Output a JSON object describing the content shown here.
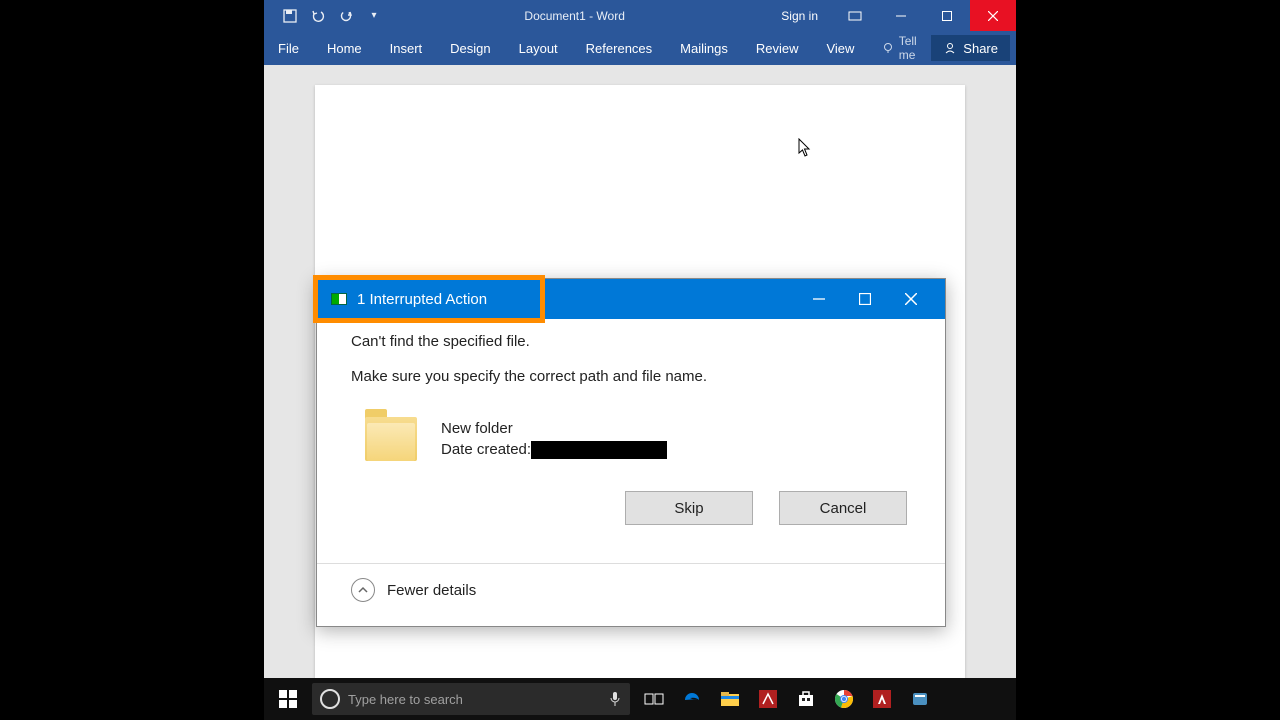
{
  "word": {
    "doc_title": "Document1  -  Word",
    "signin": "Sign in",
    "tabs": [
      "File",
      "Home",
      "Insert",
      "Design",
      "Layout",
      "References",
      "Mailings",
      "Review",
      "View"
    ],
    "tellme": "Tell me",
    "share": "Share"
  },
  "dialog": {
    "title": "1 Interrupted Action",
    "error_main": "Can't find the specified file.",
    "error_sub": "Make sure you specify the correct path and file name.",
    "item_name": "New folder",
    "date_label": "Date created:",
    "skip": "Skip",
    "cancel": "Cancel",
    "fewer": "Fewer details"
  },
  "taskbar": {
    "search_placeholder": "Type here to search"
  }
}
